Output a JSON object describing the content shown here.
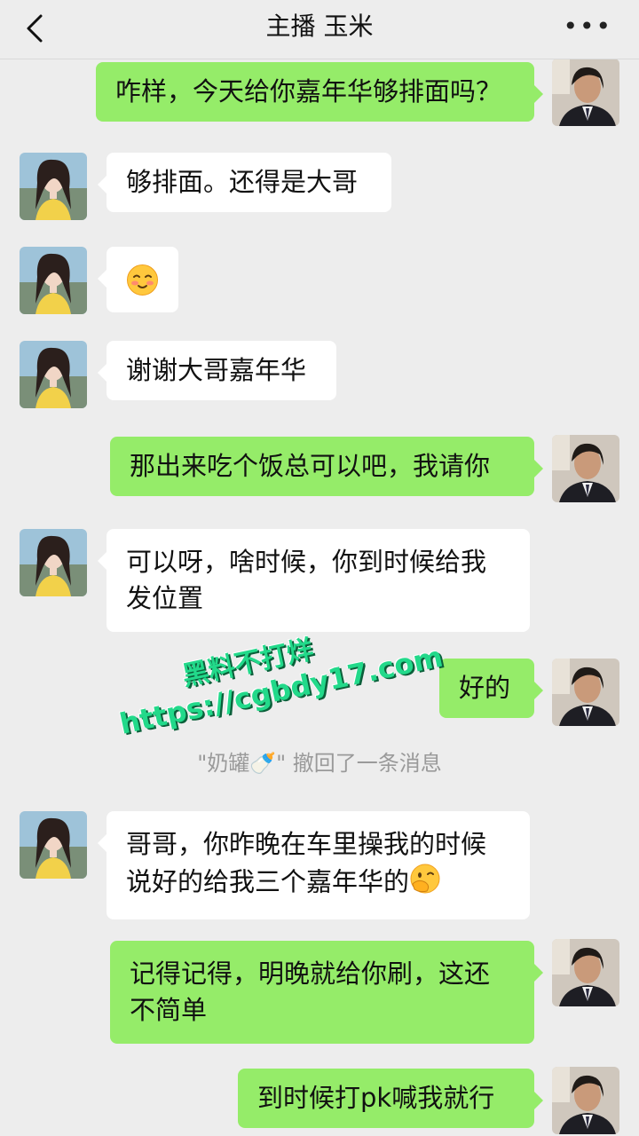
{
  "header": {
    "title": "主播 玉米",
    "more_label": "•••"
  },
  "messages": [
    {
      "side": "out",
      "text": "咋样，今天给你嘉年华够排面吗？"
    },
    {
      "side": "in",
      "text": "够排面。还得是大哥"
    },
    {
      "side": "in",
      "emoji": "blushing-face"
    },
    {
      "side": "in",
      "text": "谢谢大哥嘉年华"
    },
    {
      "side": "out",
      "text": "那出来吃个饭总可以吧，我请你"
    },
    {
      "side": "in",
      "text": "可以呀，啥时候，你到时候给我发位置"
    },
    {
      "side": "out",
      "text": "好的"
    },
    {
      "side": "in",
      "text": "哥哥，你昨晚在车里操我的时候说好的给我三个嘉年华的",
      "trailing_emoji": "face-with-hand-over-mouth"
    },
    {
      "side": "out",
      "text": "记得记得，明晚就给你刷，这还不简单"
    },
    {
      "side": "out",
      "text": "到时候打pk喊我就行"
    }
  ],
  "recall_notice": "\"奶罐🍼\" 撤回了一条消息",
  "watermark": {
    "line1": "黑料不打烊",
    "line2": "https://cgbdy17.com"
  },
  "colors": {
    "background": "#ededed",
    "incoming_bubble": "#ffffff",
    "outgoing_bubble": "#95ec69",
    "watermark": "#22d98a"
  }
}
